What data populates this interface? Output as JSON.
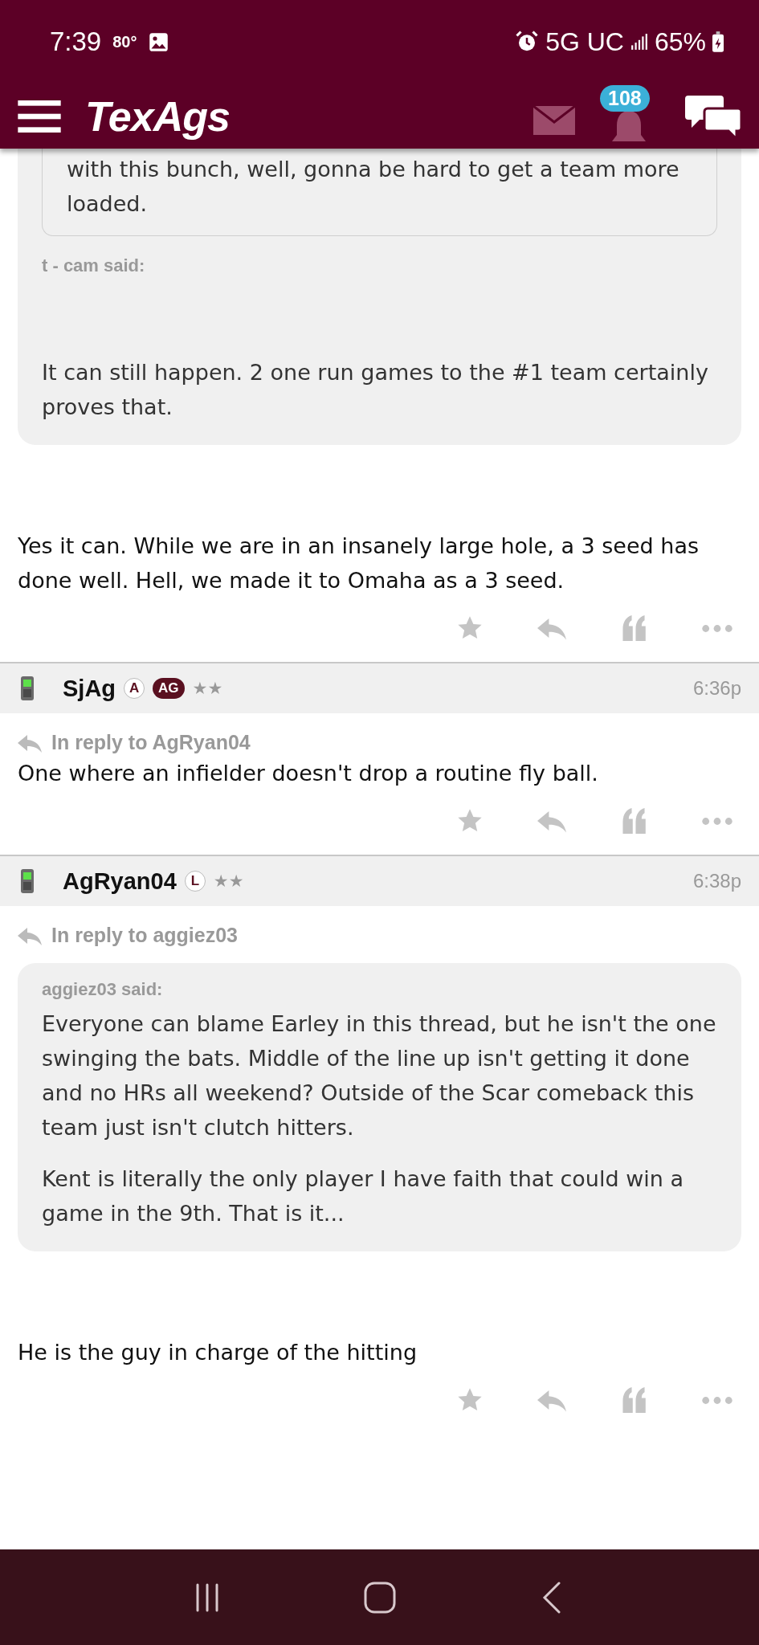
{
  "status_bar": {
    "time": "7:39",
    "temperature": "80°",
    "network": "5G UC",
    "battery": "65%"
  },
  "header": {
    "logo": "TexAgs",
    "notification_count": "108"
  },
  "posts": [
    {
      "quote": {
        "nested_quote": "with this bunch, well, gonna be hard to get a team more loaded.",
        "attribution": "t - cam said:",
        "paragraphs": [
          "It can still happen. 2 one run games to the #1 team certainly proves that."
        ]
      },
      "body": "Yes it can. While we are in an insanely large hole, a 3 seed has done well. Hell, we made it to Omaha as a 3 seed."
    },
    {
      "author": "SjAg",
      "badges": [
        {
          "label": "A",
          "kind": "outline"
        },
        {
          "label": "AG",
          "kind": "filled"
        }
      ],
      "rank": "★★",
      "time": "6:36p",
      "in_reply_to": "In reply to AgRyan04",
      "body": "One where an infielder doesn't drop a routine fly ball."
    },
    {
      "author": "AgRyan04",
      "badges": [
        {
          "label": "L",
          "kind": "outline"
        }
      ],
      "rank": "★★",
      "time": "6:38p",
      "in_reply_to": "In reply to aggiez03",
      "quote": {
        "attribution": "aggiez03 said:",
        "paragraphs": [
          "Everyone can blame Earley in this thread, but he isn't the one swinging the bats. Middle of the line up isn't getting it done and no HRs all weekend? Outside of the Scar comeback this team just isn't clutch hitters.",
          "Kent is literally the only player I have faith that could win a game in the 9th. That is it..."
        ]
      },
      "body": "He is the guy in charge of the hitting"
    }
  ]
}
